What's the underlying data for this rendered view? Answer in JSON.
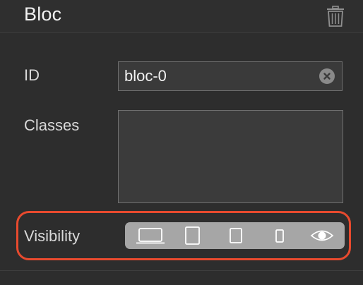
{
  "panel": {
    "title": "Bloc",
    "delete_icon": "trash-icon"
  },
  "fields": {
    "id_label": "ID",
    "id_value": "bloc-0",
    "clear_icon": "clear-x-icon",
    "classes_label": "Classes",
    "classes_value": "",
    "visibility_label": "Visibility"
  },
  "visibility": {
    "options": [
      {
        "icon": "laptop-icon",
        "device": "desktop"
      },
      {
        "icon": "tablet-icon",
        "device": "tablet"
      },
      {
        "icon": "small-tablet-icon",
        "device": "tablet-small"
      },
      {
        "icon": "phone-icon",
        "device": "phone"
      },
      {
        "icon": "eye-icon",
        "device": "preview"
      }
    ]
  },
  "colors": {
    "highlight": "#e84a2e",
    "toggle_bar": "#a6a6a6",
    "background": "#2d2d2d"
  }
}
